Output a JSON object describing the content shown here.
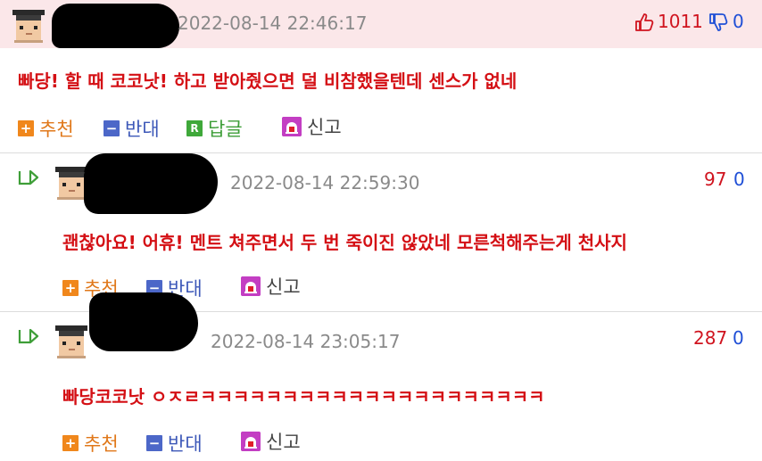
{
  "comments": [
    {
      "date": "2022-08-14 22:46:17",
      "likes": "1011",
      "dislikes": "0",
      "text": "빠당! 할 때 코코낫! 하고 받아줬으면 덜 비참했을텐데 센스가 없네",
      "actions": {
        "recommend": "추천",
        "oppose": "반대",
        "reply": "답글",
        "report": "신고",
        "reply_badge": "R"
      }
    },
    {
      "date": "2022-08-14 22:59:30",
      "likes": "97",
      "dislikes": "0",
      "text": "괜찮아요! 어휴! 멘트 쳐주면서 두 번 죽이진 않았네 모른척해주는게 천사지",
      "actions": {
        "recommend": "추천",
        "oppose": "반대",
        "report": "신고"
      }
    },
    {
      "date": "2022-08-14 23:05:17",
      "likes": "287",
      "dislikes": "0",
      "text": "빠당코코낫 ㅇㅈㄹㅋㅋㅋㅋㅋㅋㅋㅋㅋㅋㅋㅋㅋㅋㅋㅋㅋㅋㅋㅋㅋ",
      "actions": {
        "recommend": "추천",
        "oppose": "반대",
        "report": "신고"
      }
    }
  ],
  "colors": {
    "header_bg": "#fbe7e9",
    "text": "#d40f14",
    "likes": "#d0141f",
    "dislikes": "#1f4fd6",
    "date": "#8a8a8a"
  },
  "icons": [
    "avatar-icon",
    "thumb-up-icon",
    "thumb-down-icon",
    "reply-arrow-icon",
    "plus-icon",
    "minus-icon",
    "reply-badge-icon",
    "report-siren-icon"
  ]
}
